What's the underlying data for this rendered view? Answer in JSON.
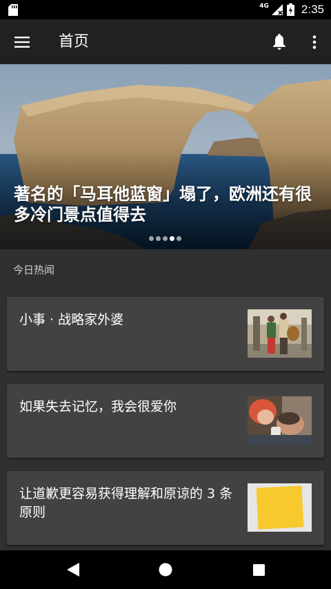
{
  "status_bar": {
    "network": "4G",
    "time": "2:35"
  },
  "app_bar": {
    "title": "首页"
  },
  "banner": {
    "title": "著名的「马耳他蓝窗」塌了，欧洲还有很多冷门景点值得去",
    "dot_count": 5,
    "active_dot": 3
  },
  "section": {
    "title": "今日热闻"
  },
  "stories": [
    {
      "title": "小事 · 战略家外婆"
    },
    {
      "title": "如果失去记忆，我会很爱你"
    },
    {
      "title": "让道歉更容易获得理解和原谅的 3 条原则"
    }
  ],
  "colors": {
    "app_bar": "#212121",
    "background": "#303030",
    "card": "#424242"
  }
}
